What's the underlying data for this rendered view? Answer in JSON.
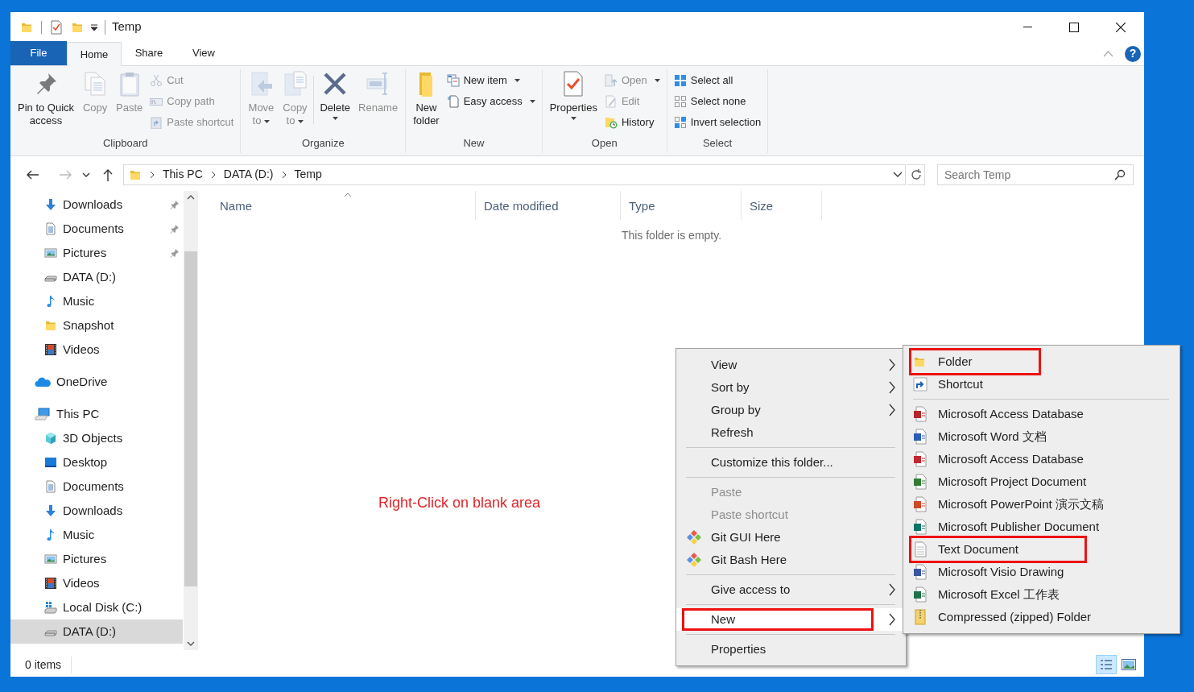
{
  "window": {
    "title": "Temp",
    "help": "?"
  },
  "ribbon_tabs": [
    {
      "label": "File",
      "kind": "file",
      "selected": false
    },
    {
      "label": "Home",
      "kind": "tab",
      "selected": true
    },
    {
      "label": "Share",
      "kind": "tab",
      "selected": false
    },
    {
      "label": "View",
      "kind": "tab",
      "selected": false
    }
  ],
  "ribbon_groups": [
    {
      "label": "Clipboard",
      "commands": [
        {
          "kind": "large",
          "lines": [
            "Pin to Quick",
            "access"
          ],
          "disabled": false,
          "dropdown": false
        },
        {
          "kind": "large",
          "lines": [
            "Copy"
          ],
          "disabled": true,
          "dropdown": false
        },
        {
          "kind": "large",
          "lines": [
            "Paste"
          ],
          "disabled": true,
          "dropdown": false
        },
        {
          "kind": "stack",
          "items": [
            {
              "label": "Cut",
              "disabled": true,
              "dropdown": false
            },
            {
              "label": "Copy path",
              "disabled": true,
              "dropdown": false
            },
            {
              "label": "Paste shortcut",
              "disabled": true,
              "dropdown": false
            }
          ]
        }
      ]
    },
    {
      "label": "Organize",
      "commands": [
        {
          "kind": "large",
          "lines": [
            "Move",
            "to"
          ],
          "disabled": true,
          "dropdown": true
        },
        {
          "kind": "large",
          "lines": [
            "Copy",
            "to"
          ],
          "disabled": true,
          "dropdown": true
        },
        {
          "kind": "divider"
        },
        {
          "kind": "large",
          "lines": [
            "Delete"
          ],
          "disabled": false,
          "dropdown": true
        },
        {
          "kind": "large",
          "lines": [
            "Rename"
          ],
          "disabled": true,
          "dropdown": false
        }
      ]
    },
    {
      "label": "New",
      "commands": [
        {
          "kind": "large",
          "lines": [
            "New",
            "folder"
          ],
          "disabled": false,
          "dropdown": false
        },
        {
          "kind": "stack",
          "items": [
            {
              "label": "New item",
              "disabled": false,
              "dropdown": true
            },
            {
              "label": "Easy access",
              "disabled": false,
              "dropdown": true
            }
          ]
        }
      ]
    },
    {
      "label": "Open",
      "commands": [
        {
          "kind": "large",
          "lines": [
            "Properties"
          ],
          "disabled": false,
          "dropdown": true
        },
        {
          "kind": "stack",
          "items": [
            {
              "label": "Open",
              "disabled": true,
              "dropdown": true
            },
            {
              "label": "Edit",
              "disabled": true,
              "dropdown": false
            },
            {
              "label": "History",
              "disabled": false,
              "dropdown": false
            }
          ]
        }
      ]
    },
    {
      "label": "Select",
      "commands": [
        {
          "kind": "stack",
          "items": [
            {
              "label": "Select all",
              "disabled": false,
              "dropdown": false
            },
            {
              "label": "Select none",
              "disabled": false,
              "dropdown": false
            },
            {
              "label": "Invert selection",
              "disabled": false,
              "dropdown": false
            }
          ]
        }
      ]
    }
  ],
  "address_bar": {
    "breadcrumbs": [
      "This PC",
      "DATA (D:)",
      "Temp"
    ]
  },
  "search": {
    "placeholder": "Search Temp"
  },
  "nav_pane": {
    "quick_access_items": [
      {
        "label": "Downloads",
        "pinned": true,
        "selected": false
      },
      {
        "label": "Documents",
        "pinned": true,
        "selected": false
      },
      {
        "label": "Pictures",
        "pinned": true,
        "selected": false
      },
      {
        "label": "DATA (D:)",
        "pinned": false,
        "selected": false
      },
      {
        "label": "Music",
        "pinned": false,
        "selected": false
      },
      {
        "label": "Snapshot",
        "pinned": false,
        "selected": false
      },
      {
        "label": "Videos",
        "pinned": false,
        "selected": false
      }
    ],
    "items": [
      {
        "label": "OneDrive",
        "selected": false
      },
      {
        "label": "This PC",
        "selected": false,
        "children": [
          {
            "label": "3D Objects",
            "selected": false
          },
          {
            "label": "Desktop",
            "selected": false
          },
          {
            "label": "Documents",
            "selected": false
          },
          {
            "label": "Downloads",
            "selected": false
          },
          {
            "label": "Music",
            "selected": false
          },
          {
            "label": "Pictures",
            "selected": false
          },
          {
            "label": "Videos",
            "selected": false
          },
          {
            "label": "Local Disk (C:)",
            "selected": false
          },
          {
            "label": "DATA (D:)",
            "selected": true
          }
        ]
      }
    ]
  },
  "file_list": {
    "columns": [
      {
        "label": "Name",
        "sorted": true
      },
      {
        "label": "Date modified",
        "sorted": false
      },
      {
        "label": "Type",
        "sorted": false
      },
      {
        "label": "Size",
        "sorted": false
      }
    ],
    "empty_message": "This folder is empty."
  },
  "annotation": "Right-Click on blank area",
  "context_menu": {
    "items": [
      {
        "kind": "item",
        "label": "View",
        "submenu": true,
        "disabled": false,
        "selected": false,
        "highlighted": false
      },
      {
        "kind": "item",
        "label": "Sort by",
        "submenu": true,
        "disabled": false,
        "selected": false,
        "highlighted": false
      },
      {
        "kind": "item",
        "label": "Group by",
        "submenu": true,
        "disabled": false,
        "selected": false,
        "highlighted": false
      },
      {
        "kind": "item",
        "label": "Refresh",
        "submenu": false,
        "disabled": false,
        "selected": false,
        "highlighted": false
      },
      {
        "kind": "separator"
      },
      {
        "kind": "item",
        "label": "Customize this folder...",
        "submenu": false,
        "disabled": false,
        "selected": false,
        "highlighted": false
      },
      {
        "kind": "separator"
      },
      {
        "kind": "item",
        "label": "Paste",
        "submenu": false,
        "disabled": true,
        "selected": false,
        "highlighted": false
      },
      {
        "kind": "item",
        "label": "Paste shortcut",
        "submenu": false,
        "disabled": true,
        "selected": false,
        "highlighted": false
      },
      {
        "kind": "item",
        "label": "Git GUI Here",
        "submenu": false,
        "disabled": false,
        "selected": false,
        "highlighted": false
      },
      {
        "kind": "item",
        "label": "Git Bash Here",
        "submenu": false,
        "disabled": false,
        "selected": false,
        "highlighted": false
      },
      {
        "kind": "separator"
      },
      {
        "kind": "item",
        "label": "Give access to",
        "submenu": true,
        "disabled": false,
        "selected": false,
        "highlighted": false
      },
      {
        "kind": "separator"
      },
      {
        "kind": "item",
        "label": "New",
        "submenu": true,
        "disabled": false,
        "selected": true,
        "highlighted": true
      },
      {
        "kind": "separator"
      },
      {
        "kind": "item",
        "label": "Properties",
        "submenu": false,
        "disabled": false,
        "selected": false,
        "highlighted": false
      }
    ]
  },
  "new_submenu": {
    "items": [
      {
        "kind": "item",
        "label": "Folder",
        "highlighted": true
      },
      {
        "kind": "item",
        "label": "Shortcut",
        "highlighted": false
      },
      {
        "kind": "separator"
      },
      {
        "kind": "item",
        "label": "Microsoft Access Database",
        "highlighted": false
      },
      {
        "kind": "item",
        "label": "Microsoft Word 文档",
        "highlighted": false
      },
      {
        "kind": "item",
        "label": "Microsoft Access Database",
        "highlighted": false
      },
      {
        "kind": "item",
        "label": "Microsoft Project Document",
        "highlighted": false
      },
      {
        "kind": "item",
        "label": "Microsoft PowerPoint 演示文稿",
        "highlighted": false
      },
      {
        "kind": "item",
        "label": "Microsoft Publisher Document",
        "highlighted": false
      },
      {
        "kind": "item",
        "label": "Text Document",
        "highlighted": true
      },
      {
        "kind": "item",
        "label": "Microsoft Visio Drawing",
        "highlighted": false
      },
      {
        "kind": "item",
        "label": "Microsoft Excel 工作表",
        "highlighted": false
      },
      {
        "kind": "item",
        "label": "Compressed (zipped) Folder",
        "highlighted": false
      }
    ]
  },
  "status_bar": {
    "item_count": "0 items",
    "views": [
      {
        "kind": "details",
        "selected": true
      },
      {
        "kind": "large_icons",
        "selected": false
      }
    ]
  }
}
